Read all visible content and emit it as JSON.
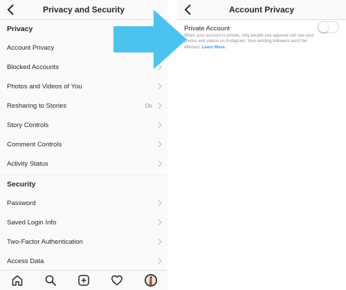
{
  "left_screen": {
    "title": "Privacy and Security",
    "sections": [
      {
        "header": "Privacy",
        "items": [
          {
            "label": "Account Privacy",
            "value": ""
          },
          {
            "label": "Blocked Accounts",
            "value": ""
          },
          {
            "label": "Photos and Videos of You",
            "value": ""
          },
          {
            "label": "Resharing to Stories",
            "value": "On"
          },
          {
            "label": "Story Controls",
            "value": ""
          },
          {
            "label": "Comment Controls",
            "value": ""
          },
          {
            "label": "Activity Status",
            "value": ""
          }
        ]
      },
      {
        "header": "Security",
        "items": [
          {
            "label": "Password",
            "value": ""
          },
          {
            "label": "Saved Login Info",
            "value": ""
          },
          {
            "label": "Two-Factor Authentication",
            "value": ""
          },
          {
            "label": "Access Data",
            "value": ""
          }
        ]
      }
    ],
    "tab_icons": [
      "home-icon",
      "search-icon",
      "add-post-icon",
      "heart-icon",
      "profile-avatar"
    ]
  },
  "right_screen": {
    "title": "Account Privacy",
    "private_account_label": "Private Account",
    "private_account_enabled": false,
    "description": "When your account is private, only people you approve can see your photos and videos on Instagram. Your existing followers won't be affected.",
    "learn_more": "Learn More."
  },
  "colors": {
    "arrow": "#4cc3ef",
    "link": "#3897f0",
    "text": "#262626",
    "muted": "#8e8e8e"
  }
}
